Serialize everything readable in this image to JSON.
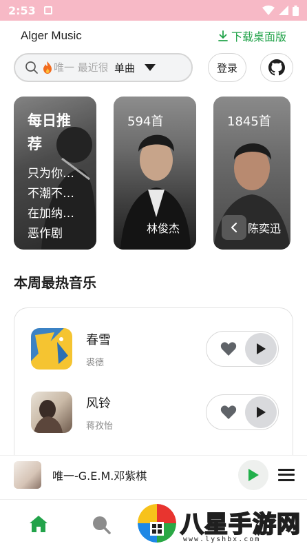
{
  "status_bar": {
    "time": "2:53"
  },
  "header": {
    "app_title": "Alger Music",
    "download_label": "下载桌面版"
  },
  "search": {
    "placeholder": "唯一 最近很火",
    "type_label": "单曲",
    "login_label": "登录"
  },
  "cards": {
    "daily": {
      "title": "每日推荐",
      "songs": [
        "只为你…",
        "不潮不…",
        "在加纳…",
        "恶作剧"
      ]
    },
    "artists": [
      {
        "count": "594首",
        "name": "林俊杰"
      },
      {
        "count": "1845首",
        "name": "陈奕迅"
      }
    ]
  },
  "hot_section": {
    "title": "本周最热音乐",
    "songs": [
      {
        "title": "春雪",
        "artist": "裘德"
      },
      {
        "title": "风铃",
        "artist": "蒋孜怡"
      }
    ]
  },
  "player": {
    "now_playing": "唯一-G.E.M.邓紫棋"
  },
  "watermark": {
    "text": "八星手游网",
    "url": "www.lyshbx.com"
  },
  "colors": {
    "status_bar": "#f7b9c6",
    "accent_green": "#22a34a",
    "text_primary": "#1f1f1f",
    "text_secondary": "#8a8a8a"
  },
  "icons": {
    "search": "search-icon",
    "dropdown": "caret-down-icon",
    "github": "github-icon",
    "download": "download-icon",
    "heart": "heart-icon",
    "play": "play-icon",
    "menu": "menu-icon",
    "home": "home-icon",
    "nav_search": "search-nav-icon"
  }
}
